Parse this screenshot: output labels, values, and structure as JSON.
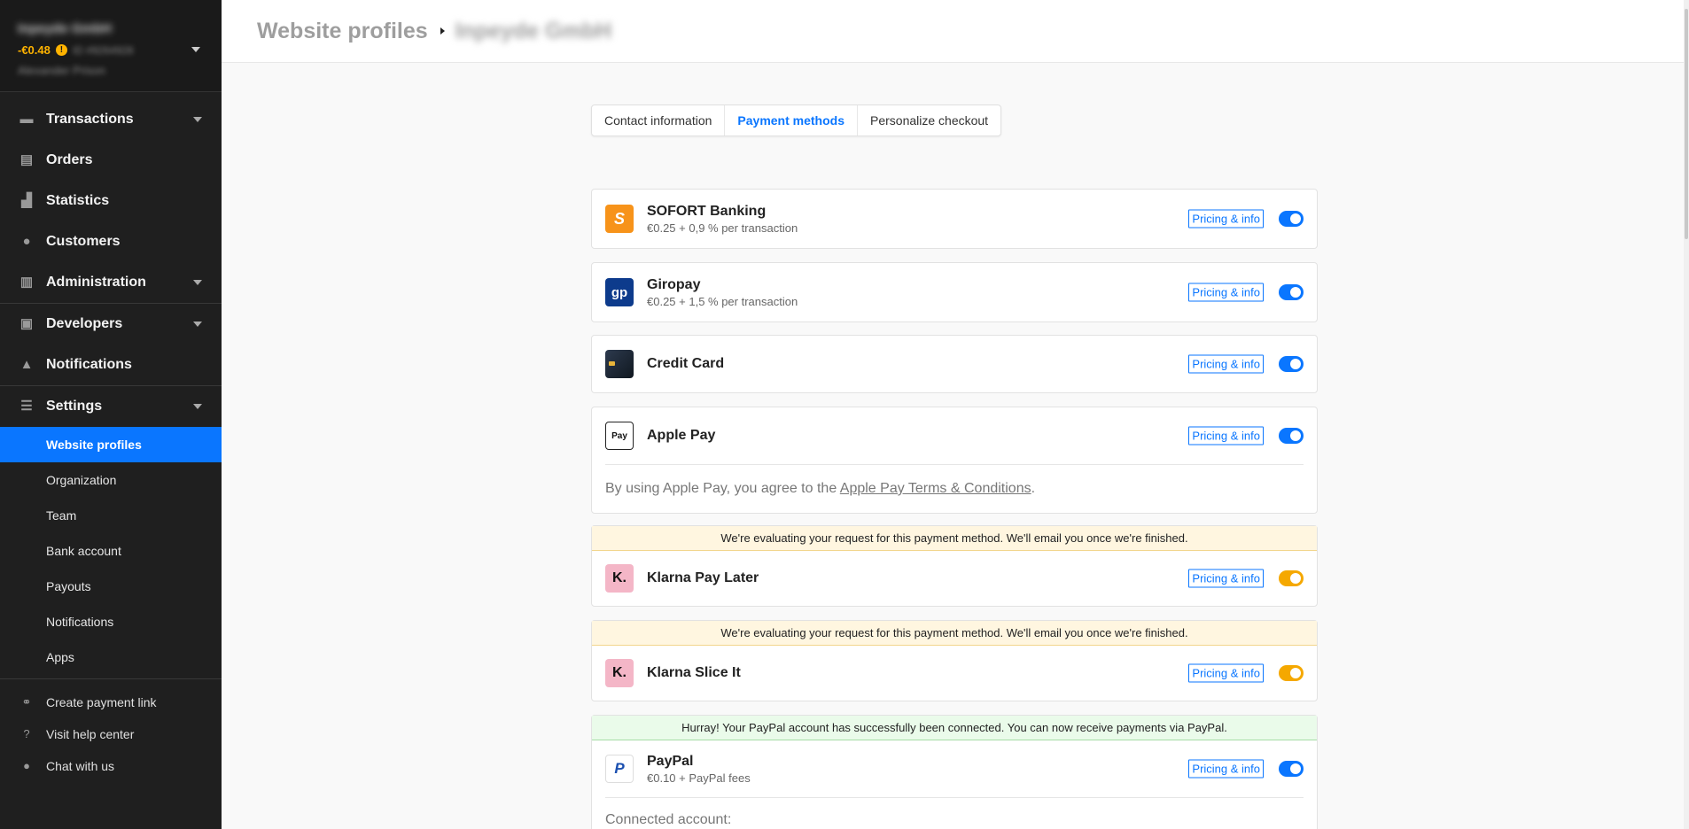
{
  "account": {
    "name": "Inpeyde GmbH",
    "balance": "-€0.48",
    "id": "ID #9264928",
    "user": "Alexander Prison"
  },
  "sidebar": {
    "main": [
      {
        "label": "Transactions",
        "icon": "transactions-icon"
      },
      {
        "label": "Orders",
        "icon": "orders-icon"
      },
      {
        "label": "Statistics",
        "icon": "statistics-icon"
      },
      {
        "label": "Customers",
        "icon": "customers-icon"
      },
      {
        "label": "Administration",
        "icon": "administration-icon"
      },
      {
        "label": "Developers",
        "icon": "developers-icon"
      },
      {
        "label": "Notifications",
        "icon": "bell-icon"
      },
      {
        "label": "Settings",
        "icon": "settings-icon"
      }
    ],
    "sub": [
      "Website profiles",
      "Organization",
      "Team",
      "Bank account",
      "Payouts",
      "Notifications",
      "Apps"
    ],
    "footer": [
      "Create payment link",
      "Visit help center",
      "Chat with us"
    ]
  },
  "header": {
    "title": "Website profiles",
    "crumb": "Inpeyde GmbH"
  },
  "tabs": [
    "Contact information",
    "Payment methods",
    "Personalize checkout"
  ],
  "pricing_label": "Pricing & info",
  "methods": {
    "sofort": {
      "name": "SOFORT Banking",
      "fee": "€0.25 + 0,9 % per transaction",
      "logo": "S"
    },
    "giropay": {
      "name": "Giropay",
      "fee": "€0.25 + 1,5 % per transaction",
      "logo": "gp"
    },
    "card": {
      "name": "Credit Card"
    },
    "applepay": {
      "name": "Apple Pay",
      "logo": "Pay",
      "note_prefix": "By using Apple Pay, you agree to the ",
      "note_link": "Apple Pay Terms & Conditions",
      "note_suffix": "."
    },
    "klarna_later": {
      "name": "Klarna Pay Later",
      "logo": "K."
    },
    "klarna_slice": {
      "name": "Klarna Slice It",
      "logo": "K."
    },
    "paypal": {
      "name": "PayPal",
      "fee": "€0.10 + PayPal fees",
      "logo": "P",
      "connected": "Connected account:"
    }
  },
  "banners": {
    "evaluating": "We're evaluating your request for this payment method. We'll email you once we're finished.",
    "paypal_ok": "Hurray! Your PayPal account has successfully been connected. You can now receive payments via PayPal."
  },
  "colors": {
    "accent": "#0a76ff",
    "pending": "#f5a800",
    "sidebar": "#1f1f1f",
    "sofort": "#f7931a",
    "giropay": "#0d3b8c",
    "klarna": "#f4b6c7"
  }
}
